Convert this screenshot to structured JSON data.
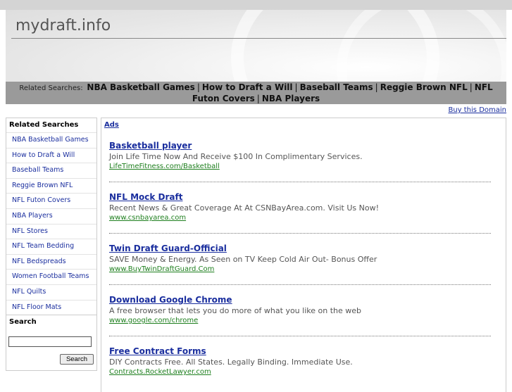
{
  "site": {
    "title": "mydraft.info"
  },
  "related_bar": {
    "label": "Related Searches:",
    "links": [
      "NBA Basketball Games",
      "How to Draft a Will",
      "Baseball Teams",
      "Reggie Brown NFL",
      "NFL Futon Covers",
      "NBA Players"
    ],
    "separator": "|"
  },
  "buy_domain": "Buy this Domain",
  "sidebar": {
    "heading": "Related Searches",
    "items": [
      "NBA Basketball Games",
      "How to Draft a Will",
      "Baseball Teams",
      "Reggie Brown NFL",
      "NFL Futon Covers",
      "NBA Players",
      "NFL Stores",
      "NFL Team Bedding",
      "NFL Bedspreads",
      "Women Football Teams",
      "NFL Quilts",
      "NFL Floor Mats"
    ]
  },
  "search": {
    "heading": "Search",
    "input_value": "",
    "button_label": "Search"
  },
  "ads": {
    "label": "Ads",
    "items": [
      {
        "title": "Basketball player",
        "description": "Join Life Time Now And Receive $100 In Complimentary Services.",
        "url": "LifeTimeFitness.com/Basketball"
      },
      {
        "title": "NFL Mock Draft",
        "description": "Recent News & Great Coverage At At CSNBayArea.com. Visit Us Now!",
        "url": "www.csnbayarea.com"
      },
      {
        "title": "Twin Draft Guard-Official",
        "description": "SAVE Money & Energy. As Seen on TV Keep Cold Air Out- Bonus Offer",
        "url": "www.BuyTwinDraftGuard.Com"
      },
      {
        "title": "Download Google Chrome",
        "description": "A free browser that lets you do more of what you like on the web",
        "url": "www.google.com/chrome"
      },
      {
        "title": "Free Contract Forms",
        "description": "DIY Contracts Free. All States. Legally Binding. Immediate Use.",
        "url": "Contracts.RocketLawyer.com"
      }
    ]
  },
  "colors": {
    "link": "#1a2e9e",
    "ad_url": "#1e7f1e",
    "related_bar_bg": "#9a9a9a",
    "top_bar": "#d4d4d4"
  }
}
